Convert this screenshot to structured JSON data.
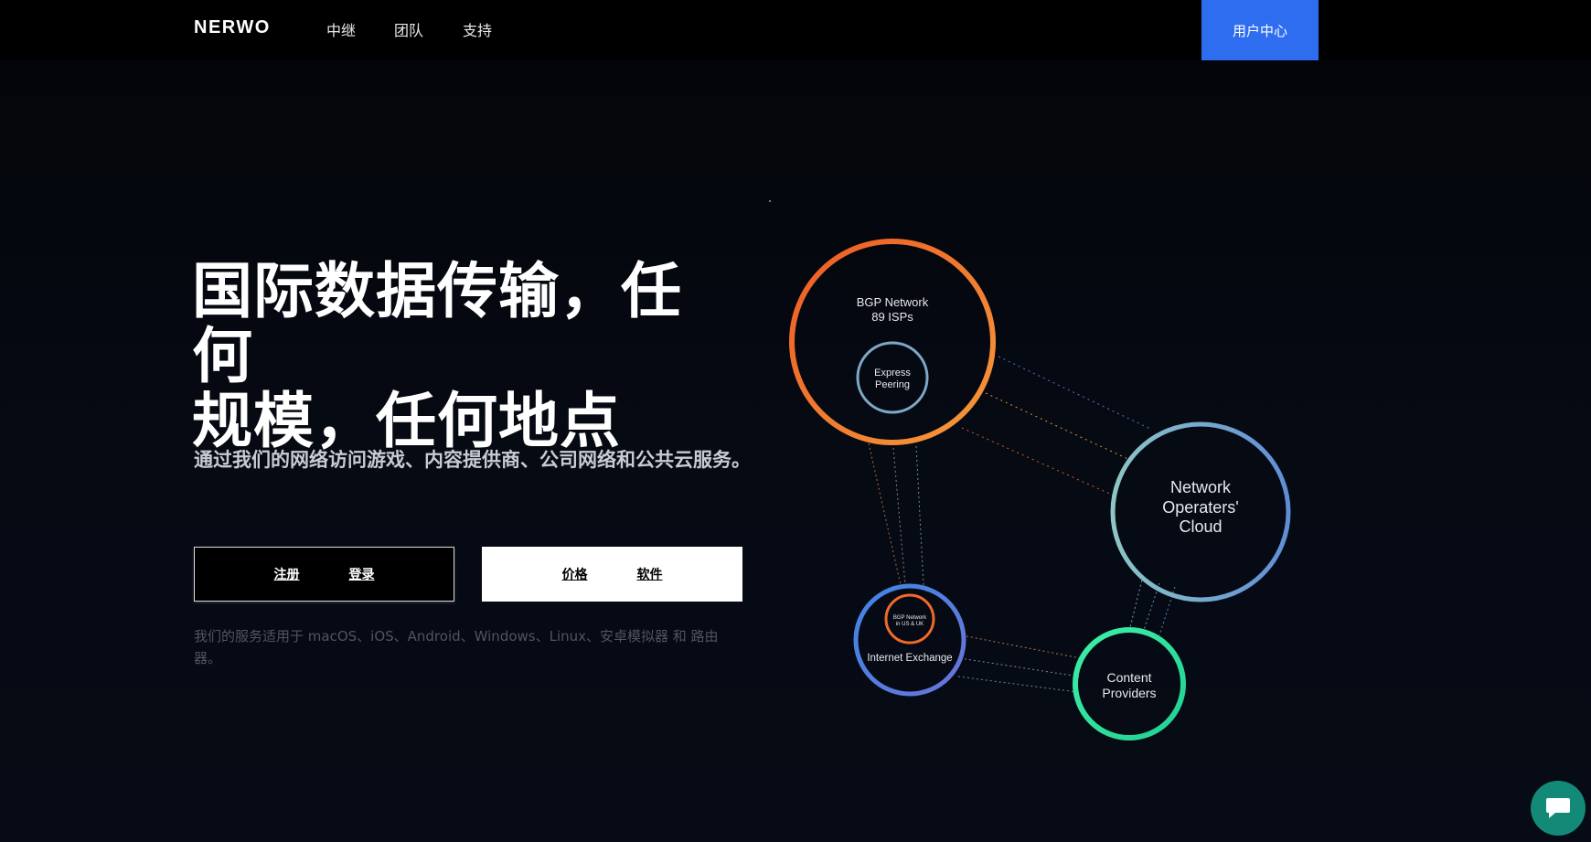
{
  "nav": {
    "brand": "NERWO",
    "links": [
      "中继",
      "团队",
      "支持"
    ],
    "user_center": "用户中心"
  },
  "hero": {
    "headline_line1": "国际数据传输，任何",
    "headline_line2": "规模，任何地点",
    "subtext": "通过我们的网络访问游戏、内容提供商、公司网络和公共云服务。",
    "buttons_dark": [
      "注册",
      "登录"
    ],
    "buttons_light": [
      "价格",
      "软件"
    ],
    "platforms": "我们的服务适用于 macOS、iOS、Android、Windows、Linux、安卓模拟器 和 路由器。"
  },
  "diagram": {
    "bgp": {
      "line1": "BGP Network",
      "line2": "89 ISPs"
    },
    "express": {
      "line1": "Express",
      "line2": "Peering"
    },
    "cloud": {
      "line1": "Network",
      "line2": "Operaters'",
      "line3": "Cloud"
    },
    "ix_inner": {
      "line1": "BGP Network",
      "line2": "in US & UK"
    },
    "ix": {
      "label": "Internet Exchange"
    },
    "content": {
      "line1": "Content",
      "line2": "Providers"
    }
  },
  "colors": {
    "accent_blue": "#2f6df0",
    "bgp_orange": "#f06a2a",
    "cloud_teal": "#7fb3c4",
    "ix_blue": "#4e7de0",
    "content_green": "#2ee6a0",
    "chat_teal": "#138a78"
  },
  "icons": {
    "chat": "chat-bubble-icon"
  }
}
